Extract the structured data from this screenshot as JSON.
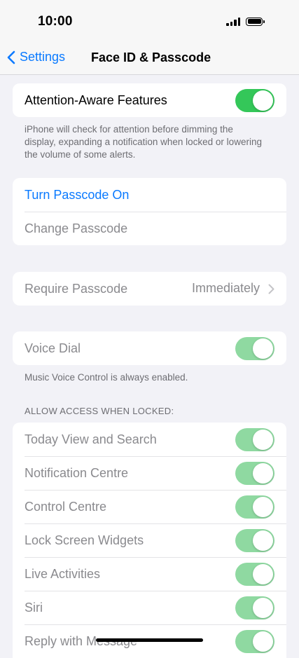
{
  "status": {
    "time": "10:00",
    "signal_icon": "cellular-signal-icon",
    "battery_icon": "battery-icon"
  },
  "nav": {
    "back_label": "Settings",
    "title": "Face ID & Passcode"
  },
  "attention": {
    "label": "Attention-Aware Features",
    "enabled": true,
    "footer": "iPhone will check for attention before dimming the display, expanding a notification when locked or lowering the volume of some alerts."
  },
  "passcode": {
    "turn_on": "Turn Passcode On",
    "change": "Change Passcode"
  },
  "require": {
    "label": "Require Passcode",
    "value": "Immediately"
  },
  "voice_dial": {
    "label": "Voice Dial",
    "enabled": true,
    "footer": "Music Voice Control is always enabled."
  },
  "locked_access": {
    "header": "ALLOW ACCESS WHEN LOCKED:",
    "items": [
      {
        "label": "Today View and Search",
        "enabled": true
      },
      {
        "label": "Notification Centre",
        "enabled": true
      },
      {
        "label": "Control Centre",
        "enabled": true
      },
      {
        "label": "Lock Screen Widgets",
        "enabled": true
      },
      {
        "label": "Live Activities",
        "enabled": true
      },
      {
        "label": "Siri",
        "enabled": true
      },
      {
        "label": "Reply with Message",
        "enabled": true
      }
    ]
  },
  "colors": {
    "accent": "#0a7aff",
    "toggle_on": "#34c759",
    "toggle_on_disabled": "#8fd9a1",
    "background": "#f2f2f7"
  }
}
